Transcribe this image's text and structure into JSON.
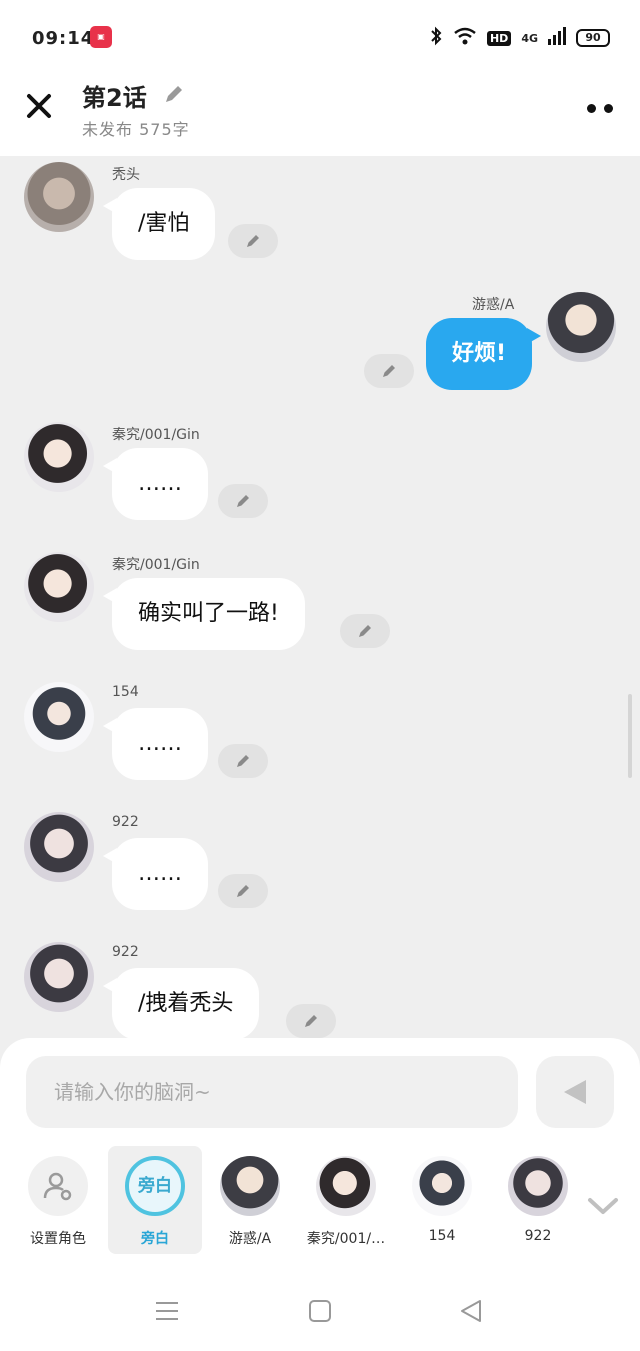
{
  "status_bar": {
    "time": "09:14",
    "app_badge": "app-logo-badge",
    "network": "4G",
    "hd": "HD",
    "battery": "90"
  },
  "header": {
    "title": "第2话",
    "subtitle": "未发布 575字"
  },
  "messages": [
    {
      "name": "秃头",
      "text": "/害怕",
      "side": "left"
    },
    {
      "name": "游惑/A",
      "text": "好烦!",
      "side": "right"
    },
    {
      "name": "秦究/001/Gin",
      "text": "……",
      "side": "left"
    },
    {
      "name": "秦究/001/Gin",
      "text": "确实叫了一路!",
      "side": "left"
    },
    {
      "name": "154",
      "text": "……",
      "side": "left"
    },
    {
      "name": "922",
      "text": "……",
      "side": "left"
    },
    {
      "name": "922",
      "text": "/拽着秃头",
      "side": "left"
    }
  ],
  "composer": {
    "placeholder": "请输入你的脑洞~"
  },
  "roles": [
    {
      "label": "设置角色",
      "icon": "add-role-icon"
    },
    {
      "label": "旁白",
      "badge": "旁白",
      "active": true
    },
    {
      "label": "游惑/A"
    },
    {
      "label": "秦究/001/…"
    },
    {
      "label": "154"
    },
    {
      "label": "922"
    }
  ],
  "colors": {
    "accent": "#29a8ef",
    "narration": "#4fc3e0",
    "background": "#efefef"
  }
}
